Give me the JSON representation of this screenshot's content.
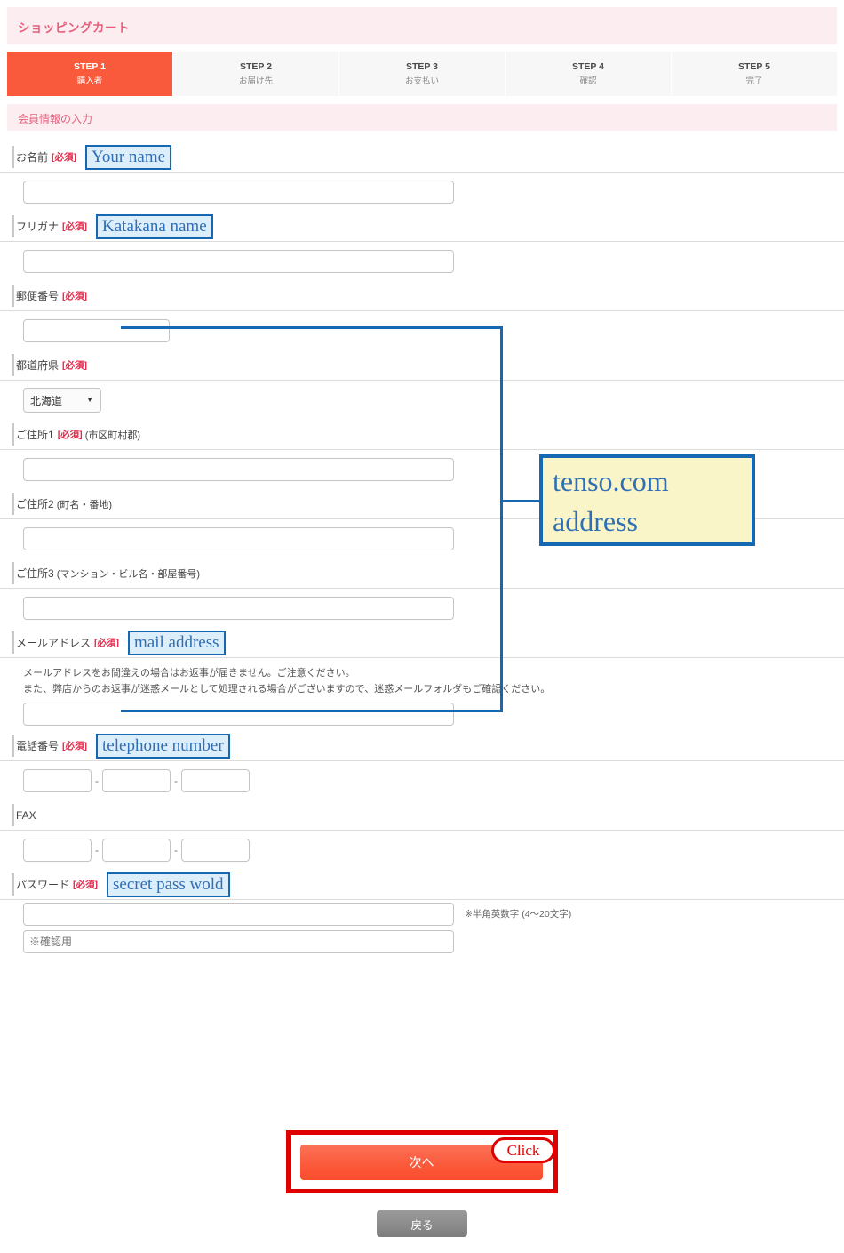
{
  "header": {
    "title": "ショッピングカート"
  },
  "steps": [
    {
      "num": "STEP 1",
      "sub": "購入者",
      "active": true
    },
    {
      "num": "STEP 2",
      "sub": "お届け先",
      "active": false
    },
    {
      "num": "STEP 3",
      "sub": "お支払い",
      "active": false
    },
    {
      "num": "STEP 4",
      "sub": "確認",
      "active": false
    },
    {
      "num": "STEP 5",
      "sub": "完了",
      "active": false
    }
  ],
  "section": {
    "title": "会員情報の入力"
  },
  "required_badge": "[必須]",
  "fields": {
    "name": {
      "label": "お名前",
      "value": ""
    },
    "kana": {
      "label": "フリガナ",
      "value": ""
    },
    "zip": {
      "label": "郵便番号",
      "value": ""
    },
    "pref": {
      "label": "都道府県",
      "selected": "北海道"
    },
    "addr1": {
      "label": "ご住所1",
      "note": "(市区町村郡)",
      "value": ""
    },
    "addr2": {
      "label": "ご住所2",
      "note": "(町名・番地)",
      "value": ""
    },
    "addr3": {
      "label": "ご住所3",
      "note": "(マンション・ビル名・部屋番号)",
      "value": ""
    },
    "email": {
      "label": "メールアドレス",
      "value": ""
    },
    "tel": {
      "label": "電話番号",
      "part1": "",
      "part2": "",
      "part3": "",
      "separator": "-"
    },
    "fax": {
      "label": "FAX",
      "part1": "",
      "part2": "",
      "part3": "",
      "separator": "-"
    },
    "password": {
      "label": "パスワード",
      "value": "",
      "hint": "※半角英数字 (4〜20文字)",
      "confirm_placeholder": "※確認用",
      "confirm_value": ""
    }
  },
  "email_notes": [
    "メールアドレスをお間違えの場合はお返事が届きません。ご注意ください。",
    "また、弊店からのお返事が迷惑メールとして処理される場合がございますので、迷惑メールフォルダもご確認ください。"
  ],
  "annotations": {
    "name": "Your name",
    "kana": "Katakana name",
    "tenso_line1": "tenso.com",
    "tenso_line2": "address",
    "email": "mail address",
    "tel": "telephone number",
    "password": "secret pass wold",
    "click": "Click"
  },
  "buttons": {
    "next": "次へ",
    "back": "戻る"
  },
  "colors": {
    "accent_orange": "#fa5a3c",
    "header_pink_bg": "#fceef0",
    "header_pink_text": "#e5607c",
    "required_red": "#e8264a",
    "annotation_blue": "#1668b3",
    "annotation_chip_bg": "#ddeefb",
    "callout_yellow": "#faf5c8",
    "highlight_red": "#e00000"
  }
}
